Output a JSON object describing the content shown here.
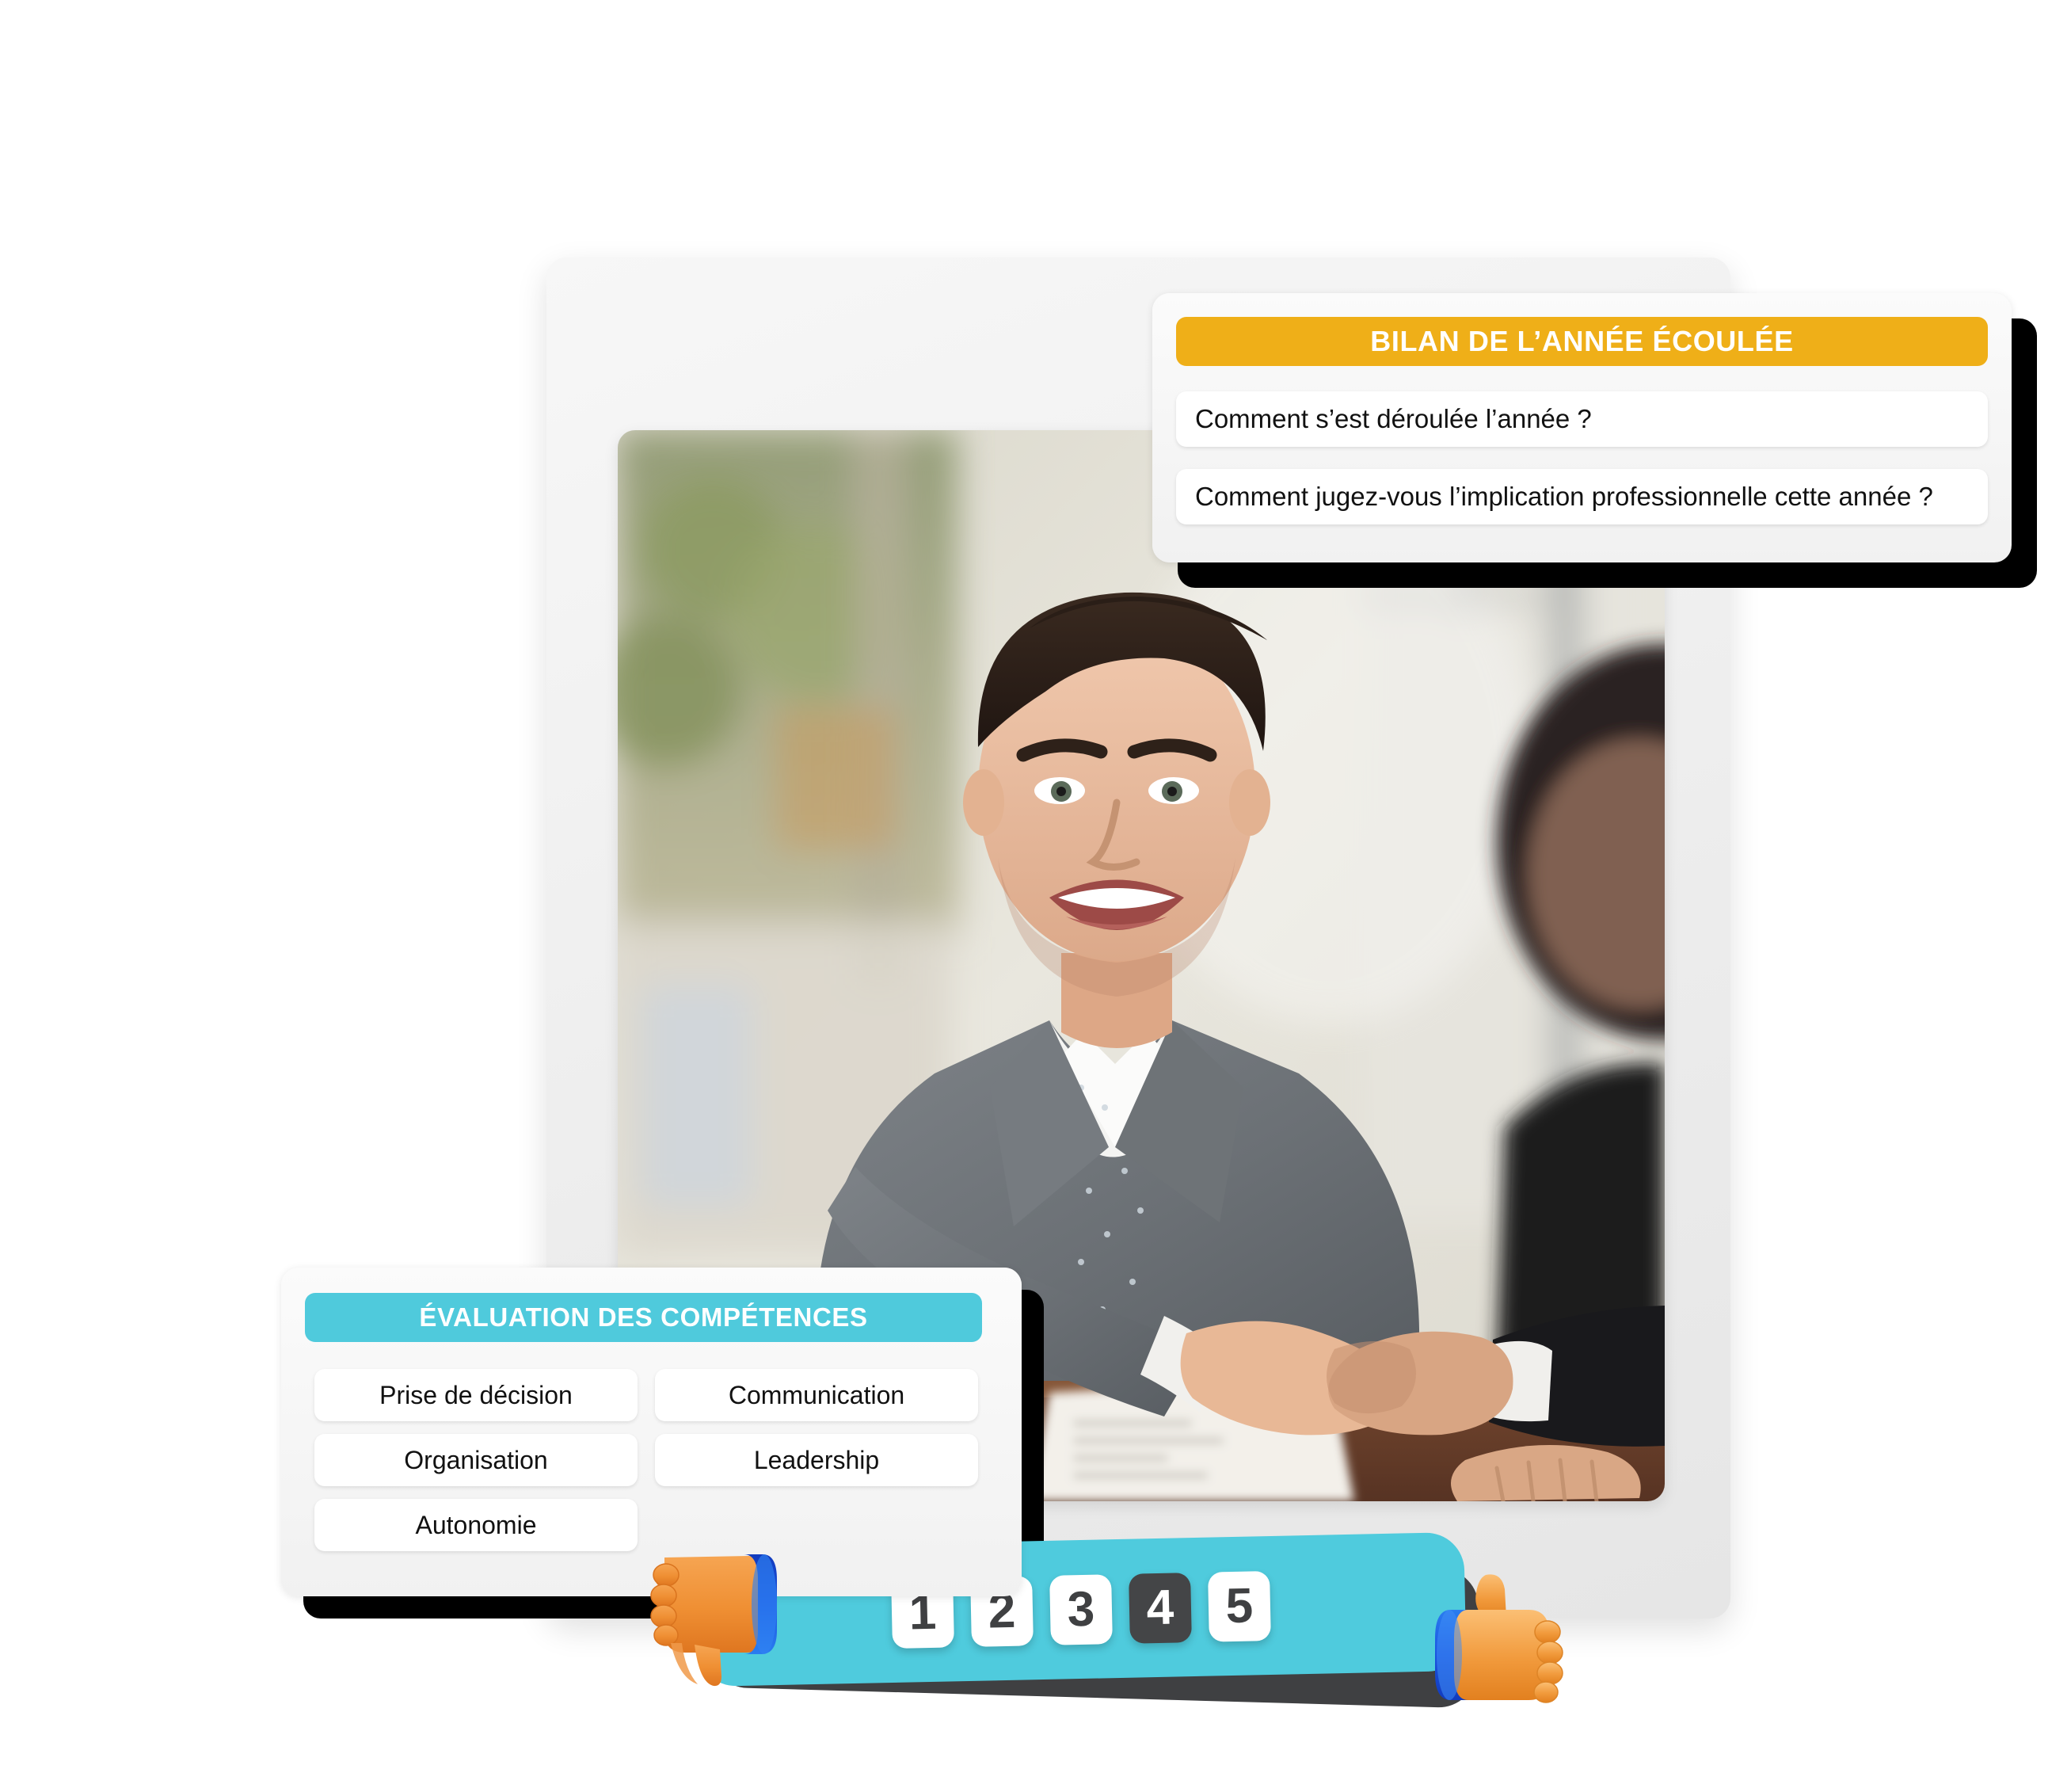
{
  "photo": {
    "alt": "Two men shaking hands across a desk during a job interview, one smiling in a grey blazer"
  },
  "bilan_card": {
    "header": "BILAN DE L’ANNÉE ÉCOULÉE",
    "header_color": "#EFAF18",
    "questions": [
      "Comment s’est déroulée l’année ?",
      "Comment jugez-vous l’implication professionnelle cette année ?"
    ]
  },
  "competences_card": {
    "header": "ÉVALUATION DES COMPÉTENCES",
    "header_color": "#4FCADC",
    "skills": [
      "Prise de décision",
      "Organisation",
      "Autonomie",
      "Communication",
      "Leadership"
    ]
  },
  "rating": {
    "bar_color": "#4FCBDD",
    "shadow_color": "#3f4042",
    "selected_value": "4",
    "values": [
      "1",
      "2",
      "3",
      "4",
      "5"
    ],
    "icons": {
      "left": "thumbs-down-icon",
      "right": "thumbs-up-icon"
    }
  }
}
